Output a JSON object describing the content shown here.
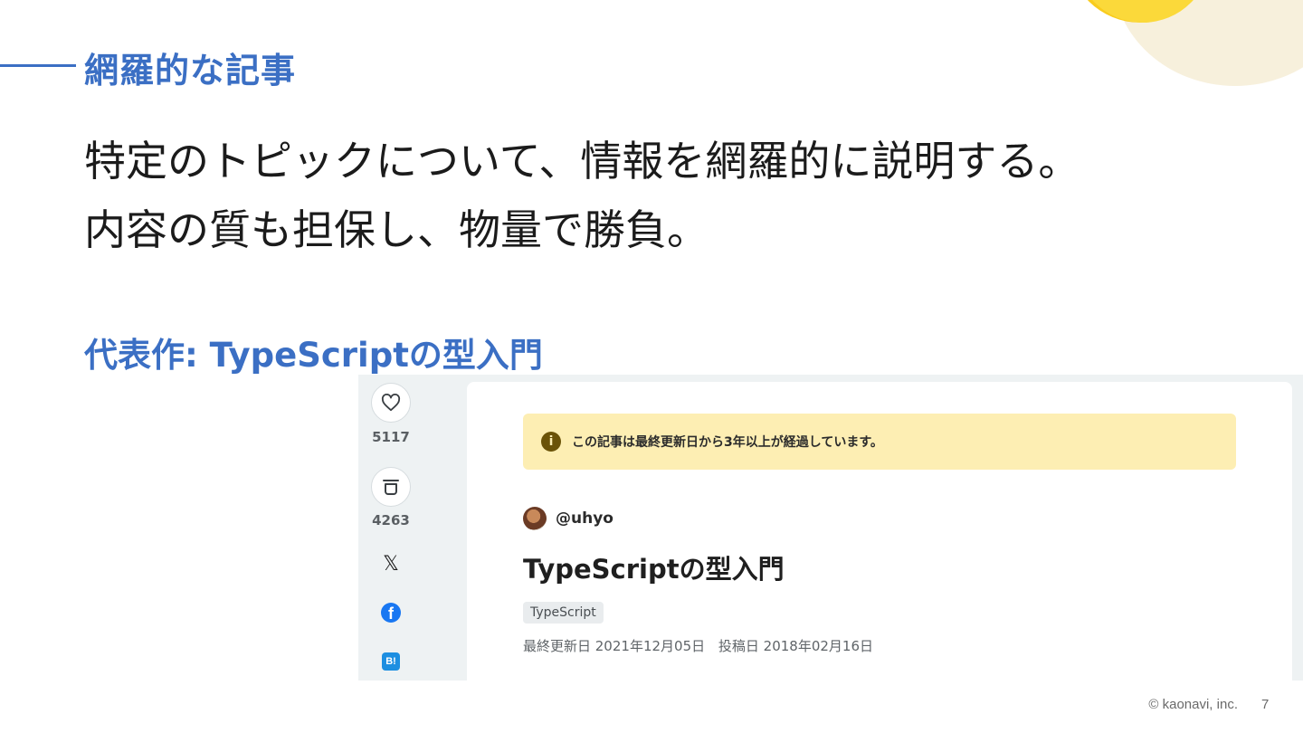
{
  "slide": {
    "section_title": "網羅的な記事",
    "lead_lines": [
      "特定のトピックについて、情報を網羅的に説明する。",
      "内容の質も担保し、物量で勝負。"
    ],
    "work_title": "代表作: TypeScriptの型入門",
    "footer": "© kaonavi, inc.",
    "page_number": "7",
    "accent_color": "#3b6fc4"
  },
  "article": {
    "like_count": "5117",
    "stock_count": "4263",
    "notice": "この記事は最終更新日から3年以上が経過しています。",
    "author": "@uhyo",
    "title": "TypeScriptの型入門",
    "tag": "TypeScript",
    "updated": "最終更新日 2021年12月05日",
    "posted": "投稿日 2018年02月16日",
    "icons": {
      "like": "heart-icon",
      "stock": "stock-icon",
      "x": "x-logo-icon",
      "facebook": "facebook-icon",
      "hatena": "hatena-bookmark-icon",
      "info": "info-icon"
    },
    "share_labels": {
      "x": "𝕏",
      "facebook": "f",
      "hatena": "B!",
      "info": "i"
    }
  }
}
